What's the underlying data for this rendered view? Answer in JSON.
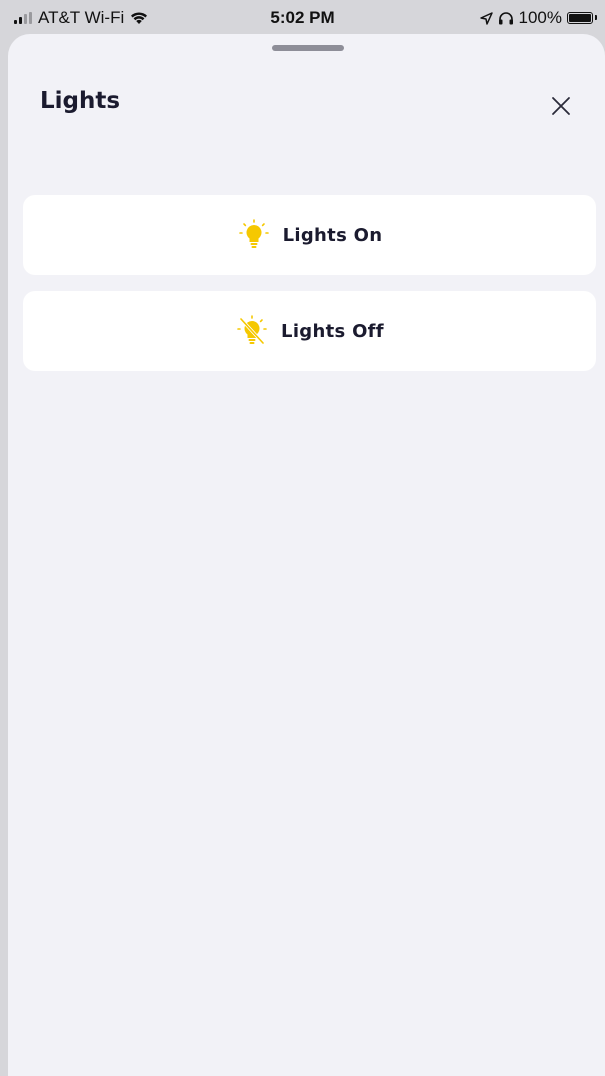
{
  "status_bar": {
    "carrier": "AT&T Wi-Fi",
    "time": "5:02 PM",
    "battery": "100%",
    "battery_level": 1.0
  },
  "sheet": {
    "title": "Lights",
    "close_icon": "close-icon"
  },
  "actions": [
    {
      "label": "Lights On",
      "icon": "lightbulb-on-icon",
      "icon_color": "#f5c800"
    },
    {
      "label": "Lights Off",
      "icon": "lightbulb-off-icon",
      "icon_color": "#f5c800"
    }
  ],
  "colors": {
    "background": "#f2f2f7",
    "card": "#ffffff",
    "text": "#1b1b2f",
    "accent": "#f5c800"
  }
}
